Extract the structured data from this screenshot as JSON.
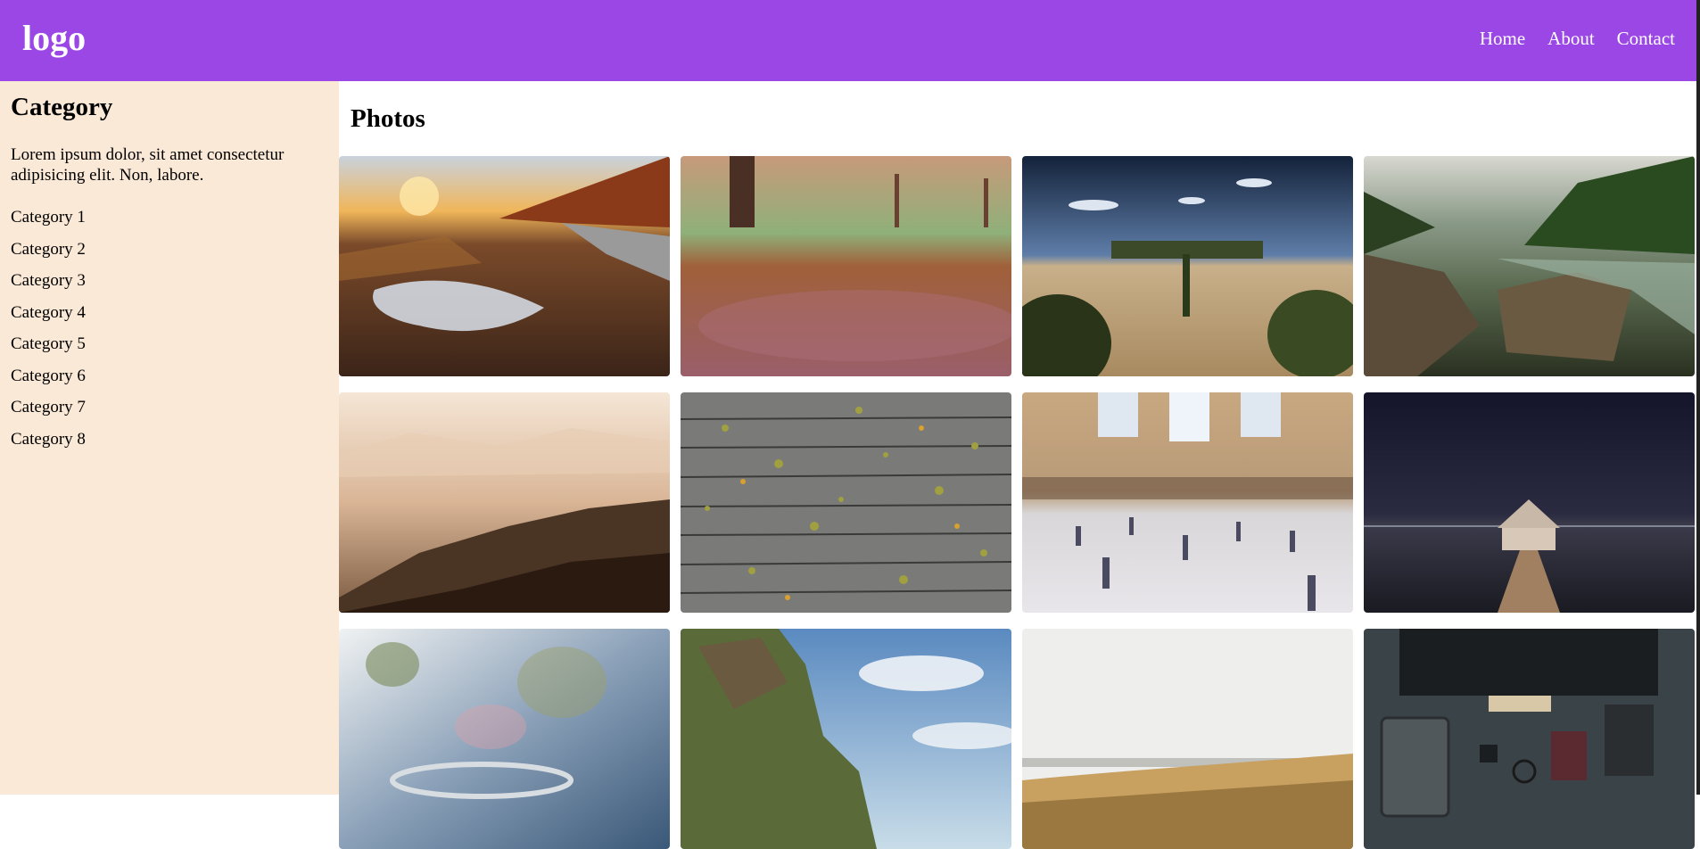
{
  "header": {
    "logo": "logo",
    "nav": [
      "Home",
      "About",
      "Contact"
    ]
  },
  "sidebar": {
    "title": "Category",
    "description": "Lorem ipsum dolor, sit amet consectetur adipisicing elit. Non, labore.",
    "categories": [
      "Category 1",
      "Category 2",
      "Category 3",
      "Category 4",
      "Category 5",
      "Category 6",
      "Category 7",
      "Category 8"
    ]
  },
  "main": {
    "title": "Photos"
  },
  "photos": [
    "road-puddle-sunset",
    "autumn-leaves-path",
    "tuscany-villa-cypress",
    "river-rocks-forest",
    "misty-mountains",
    "wooden-planks-leaves",
    "grand-central-crowd",
    "boathouse-night",
    "steaming-cup-blur",
    "cliff-coast-sky",
    "beach-grass-sea",
    "desk-workspace-top"
  ],
  "colors": {
    "header": "#9b47e6",
    "sidebar": "#fbe9d7"
  }
}
